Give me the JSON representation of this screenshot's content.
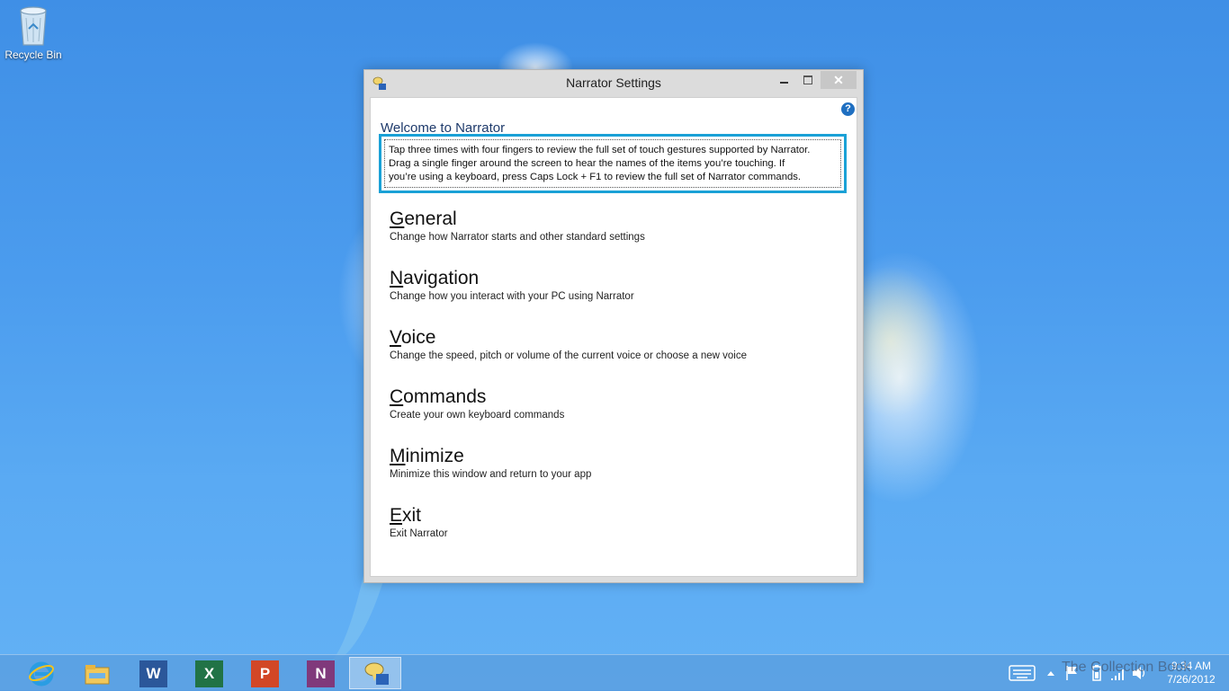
{
  "desktop": {
    "recycle_bin_label": "Recycle Bin"
  },
  "window": {
    "title": "Narrator Settings",
    "controls": {
      "minimize": "minimize",
      "maximize": "maximize",
      "close": "✕"
    },
    "help_glyph": "?",
    "welcome": "Welcome to Narrator",
    "info_line1": "Tap three times with four fingers to review the full set of touch gestures supported by Narrator.",
    "info_line2": "Drag a single finger around the screen to hear the names of the items you’re touching.  If",
    "info_line3": "you’re using a keyboard, press Caps Lock + F1 to review the full set of Narrator commands.",
    "items": [
      {
        "access": "G",
        "rest": "eneral",
        "desc": "Change how Narrator starts and other standard settings"
      },
      {
        "access": "N",
        "rest": "avigation",
        "desc": "Change how you interact with your PC using Narrator"
      },
      {
        "access": "V",
        "rest": "oice",
        "desc": "Change the speed, pitch or volume of the current voice or choose a new voice"
      },
      {
        "access": "C",
        "rest": "ommands",
        "desc": "Create your own keyboard commands"
      },
      {
        "access": "M",
        "rest": "inimize",
        "desc": "Minimize this window and return to your app"
      },
      {
        "access": "E",
        "rest": "xit",
        "desc": "Exit Narrator"
      }
    ]
  },
  "taskbar": {
    "word_letter": "W",
    "excel_letter": "X",
    "powerpoint_letter": "P",
    "onenote_letter": "N",
    "time": "9:34 AM",
    "date": "7/26/2012",
    "colors": {
      "word": "#2b579a",
      "excel": "#217346",
      "powerpoint": "#d24726",
      "onenote": "#80397b",
      "accent_border": "#1aa1d6"
    },
    "icons": [
      "internet-explorer-icon",
      "file-explorer-icon",
      "word-icon",
      "excel-icon",
      "powerpoint-icon",
      "onenote-icon",
      "narrator-icon"
    ]
  },
  "watermark": "The Collection Book"
}
